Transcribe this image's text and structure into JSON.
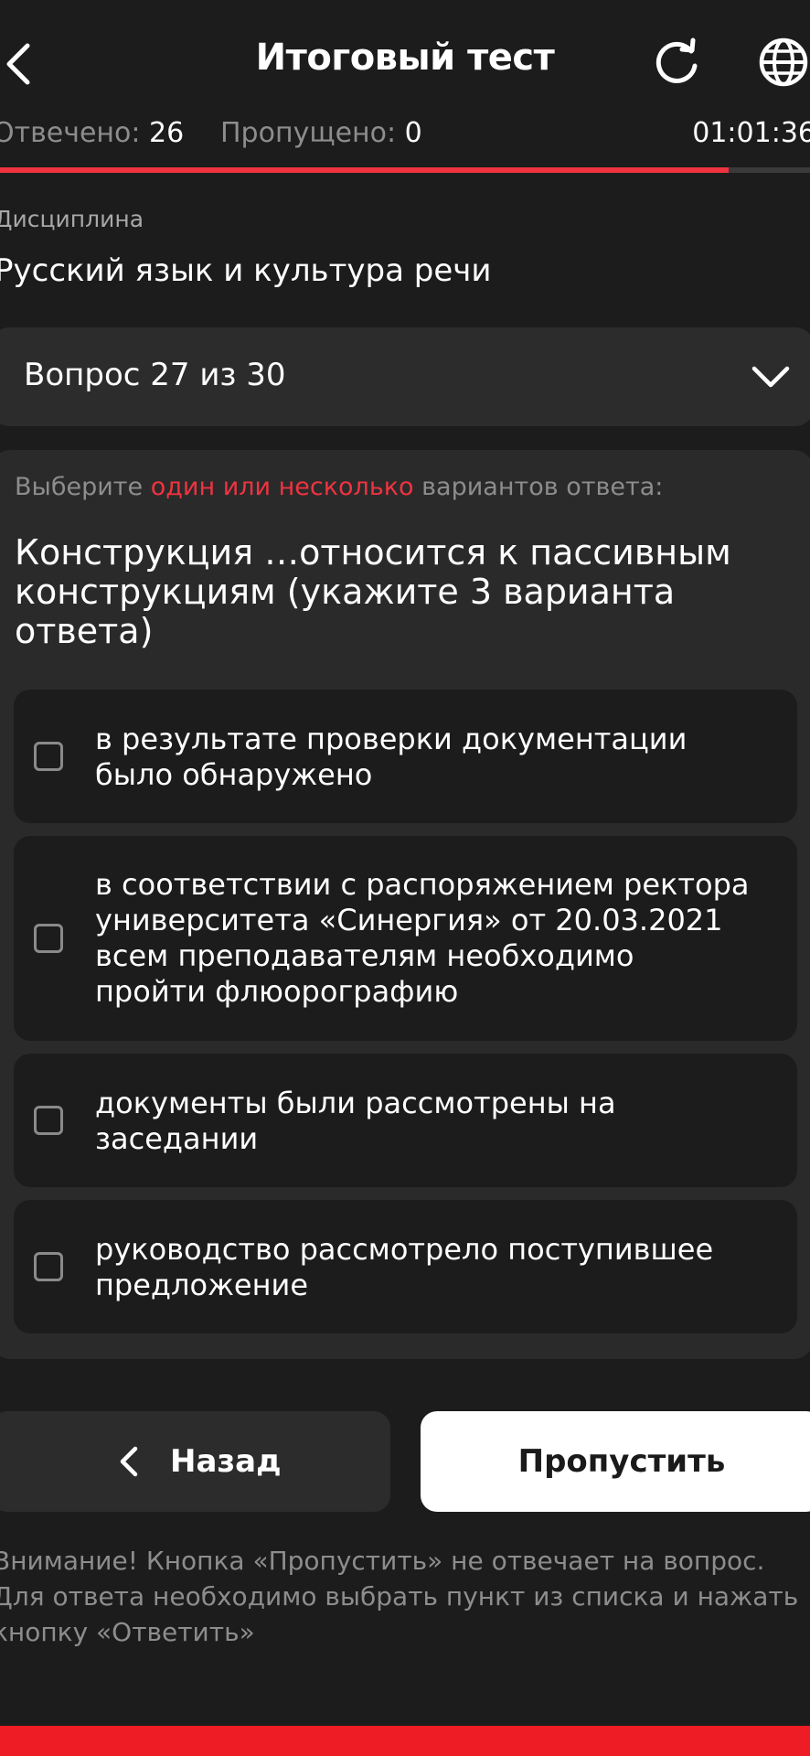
{
  "header": {
    "title": "Итоговый тест"
  },
  "stats": {
    "answered_label": "Отвечено:",
    "answered_value": "26",
    "skipped_label": "Пропущено:",
    "skipped_value": "0",
    "timer": "01:01:36",
    "progress": 0.9
  },
  "discipline": {
    "label": "Дисциплина",
    "value": "Русский язык и культура речи"
  },
  "question_selector": {
    "label": "Вопрос 27 из 30"
  },
  "question": {
    "instruction_prefix": "Выберите ",
    "instruction_accent": "один или несколько",
    "instruction_suffix": " вариантов ответа:",
    "text": "Конструкция …относится к пассивным конструкциям (укажите 3 варианта ответа)",
    "options": [
      "в результате проверки документации было обнаружено",
      "в соответствии с распоряжением ректора университета «Синергия» от 20.03.2021 всем преподавателям необходимо пройти флюорографию",
      "документы были рассмотрены на заседании",
      "руководство рассмотрело поступившее предложение"
    ]
  },
  "buttons": {
    "back": "Назад",
    "skip": "Пропустить"
  },
  "notice": "Внимание! Кнопка «Пропустить» не отвечает на вопрос. Для ответа необходимо выбрать пункт из списка и нажать кнопку «Ответить»",
  "colors": {
    "accent": "#ef3340",
    "background": "#1c1c1c",
    "card": "#2a2a2a",
    "bottom_bar": "#ee1c25"
  }
}
